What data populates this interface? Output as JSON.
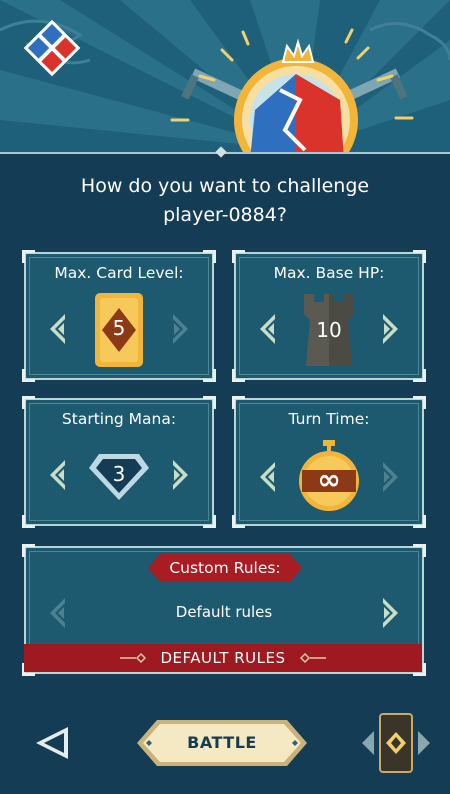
{
  "title": {
    "line1": "How do you want to challenge",
    "line2": "player-0884?"
  },
  "panels": {
    "card_level": {
      "label": "Max. Card Level:",
      "value": "5"
    },
    "base_hp": {
      "label": "Max. Base HP:",
      "value": "10"
    },
    "starting_mana": {
      "label": "Starting Mana:",
      "value": "3"
    },
    "turn_time": {
      "label": "Turn Time:",
      "value": "∞"
    }
  },
  "custom_rules": {
    "label": "Custom Rules:",
    "value": "Default rules",
    "banner": "DEFAULT RULES"
  },
  "footer": {
    "battle_label": "BATTLE"
  },
  "icons": {
    "logo": "crossed-swords-shield-icon",
    "back": "back-arrow-icon",
    "deck": "deck-card-icon"
  },
  "colors": {
    "background": "#143d55",
    "panel": "#1d5a70",
    "panel_border": "#b8d6d8",
    "banner_red": "#9e1a20",
    "gold": "#f2b53a",
    "battle_button": "#f5e9c4"
  }
}
